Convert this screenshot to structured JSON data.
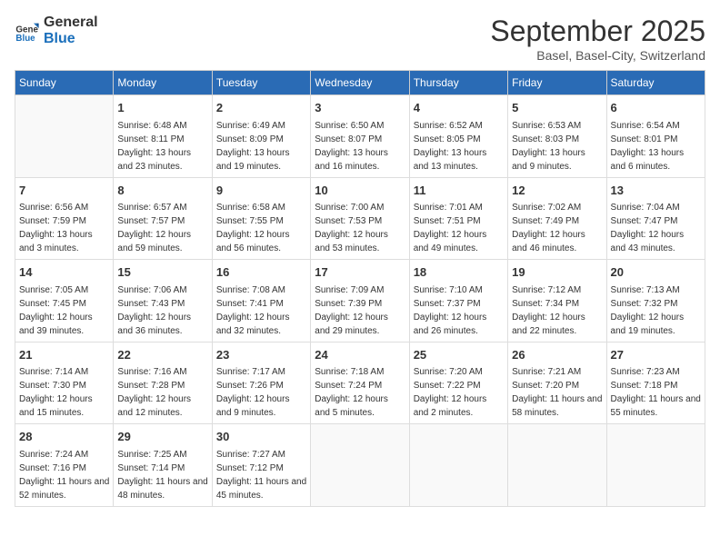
{
  "header": {
    "logo_general": "General",
    "logo_blue": "Blue",
    "month_year": "September 2025",
    "location": "Basel, Basel-City, Switzerland"
  },
  "days_of_week": [
    "Sunday",
    "Monday",
    "Tuesday",
    "Wednesday",
    "Thursday",
    "Friday",
    "Saturday"
  ],
  "weeks": [
    [
      {
        "day": "",
        "sunrise": "",
        "sunset": "",
        "daylight": ""
      },
      {
        "day": "1",
        "sunrise": "Sunrise: 6:48 AM",
        "sunset": "Sunset: 8:11 PM",
        "daylight": "Daylight: 13 hours and 23 minutes."
      },
      {
        "day": "2",
        "sunrise": "Sunrise: 6:49 AM",
        "sunset": "Sunset: 8:09 PM",
        "daylight": "Daylight: 13 hours and 19 minutes."
      },
      {
        "day": "3",
        "sunrise": "Sunrise: 6:50 AM",
        "sunset": "Sunset: 8:07 PM",
        "daylight": "Daylight: 13 hours and 16 minutes."
      },
      {
        "day": "4",
        "sunrise": "Sunrise: 6:52 AM",
        "sunset": "Sunset: 8:05 PM",
        "daylight": "Daylight: 13 hours and 13 minutes."
      },
      {
        "day": "5",
        "sunrise": "Sunrise: 6:53 AM",
        "sunset": "Sunset: 8:03 PM",
        "daylight": "Daylight: 13 hours and 9 minutes."
      },
      {
        "day": "6",
        "sunrise": "Sunrise: 6:54 AM",
        "sunset": "Sunset: 8:01 PM",
        "daylight": "Daylight: 13 hours and 6 minutes."
      }
    ],
    [
      {
        "day": "7",
        "sunrise": "Sunrise: 6:56 AM",
        "sunset": "Sunset: 7:59 PM",
        "daylight": "Daylight: 13 hours and 3 minutes."
      },
      {
        "day": "8",
        "sunrise": "Sunrise: 6:57 AM",
        "sunset": "Sunset: 7:57 PM",
        "daylight": "Daylight: 12 hours and 59 minutes."
      },
      {
        "day": "9",
        "sunrise": "Sunrise: 6:58 AM",
        "sunset": "Sunset: 7:55 PM",
        "daylight": "Daylight: 12 hours and 56 minutes."
      },
      {
        "day": "10",
        "sunrise": "Sunrise: 7:00 AM",
        "sunset": "Sunset: 7:53 PM",
        "daylight": "Daylight: 12 hours and 53 minutes."
      },
      {
        "day": "11",
        "sunrise": "Sunrise: 7:01 AM",
        "sunset": "Sunset: 7:51 PM",
        "daylight": "Daylight: 12 hours and 49 minutes."
      },
      {
        "day": "12",
        "sunrise": "Sunrise: 7:02 AM",
        "sunset": "Sunset: 7:49 PM",
        "daylight": "Daylight: 12 hours and 46 minutes."
      },
      {
        "day": "13",
        "sunrise": "Sunrise: 7:04 AM",
        "sunset": "Sunset: 7:47 PM",
        "daylight": "Daylight: 12 hours and 43 minutes."
      }
    ],
    [
      {
        "day": "14",
        "sunrise": "Sunrise: 7:05 AM",
        "sunset": "Sunset: 7:45 PM",
        "daylight": "Daylight: 12 hours and 39 minutes."
      },
      {
        "day": "15",
        "sunrise": "Sunrise: 7:06 AM",
        "sunset": "Sunset: 7:43 PM",
        "daylight": "Daylight: 12 hours and 36 minutes."
      },
      {
        "day": "16",
        "sunrise": "Sunrise: 7:08 AM",
        "sunset": "Sunset: 7:41 PM",
        "daylight": "Daylight: 12 hours and 32 minutes."
      },
      {
        "day": "17",
        "sunrise": "Sunrise: 7:09 AM",
        "sunset": "Sunset: 7:39 PM",
        "daylight": "Daylight: 12 hours and 29 minutes."
      },
      {
        "day": "18",
        "sunrise": "Sunrise: 7:10 AM",
        "sunset": "Sunset: 7:37 PM",
        "daylight": "Daylight: 12 hours and 26 minutes."
      },
      {
        "day": "19",
        "sunrise": "Sunrise: 7:12 AM",
        "sunset": "Sunset: 7:34 PM",
        "daylight": "Daylight: 12 hours and 22 minutes."
      },
      {
        "day": "20",
        "sunrise": "Sunrise: 7:13 AM",
        "sunset": "Sunset: 7:32 PM",
        "daylight": "Daylight: 12 hours and 19 minutes."
      }
    ],
    [
      {
        "day": "21",
        "sunrise": "Sunrise: 7:14 AM",
        "sunset": "Sunset: 7:30 PM",
        "daylight": "Daylight: 12 hours and 15 minutes."
      },
      {
        "day": "22",
        "sunrise": "Sunrise: 7:16 AM",
        "sunset": "Sunset: 7:28 PM",
        "daylight": "Daylight: 12 hours and 12 minutes."
      },
      {
        "day": "23",
        "sunrise": "Sunrise: 7:17 AM",
        "sunset": "Sunset: 7:26 PM",
        "daylight": "Daylight: 12 hours and 9 minutes."
      },
      {
        "day": "24",
        "sunrise": "Sunrise: 7:18 AM",
        "sunset": "Sunset: 7:24 PM",
        "daylight": "Daylight: 12 hours and 5 minutes."
      },
      {
        "day": "25",
        "sunrise": "Sunrise: 7:20 AM",
        "sunset": "Sunset: 7:22 PM",
        "daylight": "Daylight: 12 hours and 2 minutes."
      },
      {
        "day": "26",
        "sunrise": "Sunrise: 7:21 AM",
        "sunset": "Sunset: 7:20 PM",
        "daylight": "Daylight: 11 hours and 58 minutes."
      },
      {
        "day": "27",
        "sunrise": "Sunrise: 7:23 AM",
        "sunset": "Sunset: 7:18 PM",
        "daylight": "Daylight: 11 hours and 55 minutes."
      }
    ],
    [
      {
        "day": "28",
        "sunrise": "Sunrise: 7:24 AM",
        "sunset": "Sunset: 7:16 PM",
        "daylight": "Daylight: 11 hours and 52 minutes."
      },
      {
        "day": "29",
        "sunrise": "Sunrise: 7:25 AM",
        "sunset": "Sunset: 7:14 PM",
        "daylight": "Daylight: 11 hours and 48 minutes."
      },
      {
        "day": "30",
        "sunrise": "Sunrise: 7:27 AM",
        "sunset": "Sunset: 7:12 PM",
        "daylight": "Daylight: 11 hours and 45 minutes."
      },
      {
        "day": "",
        "sunrise": "",
        "sunset": "",
        "daylight": ""
      },
      {
        "day": "",
        "sunrise": "",
        "sunset": "",
        "daylight": ""
      },
      {
        "day": "",
        "sunrise": "",
        "sunset": "",
        "daylight": ""
      },
      {
        "day": "",
        "sunrise": "",
        "sunset": "",
        "daylight": ""
      }
    ]
  ]
}
